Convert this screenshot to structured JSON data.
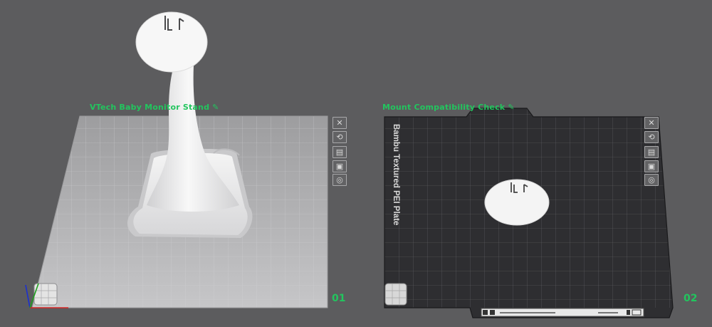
{
  "plates": [
    {
      "name": "VTech Baby Monitor Stand",
      "number": "01",
      "edit_icon": "pencil-icon",
      "surface": "smooth-cool-plate",
      "tools": [
        "close-icon",
        "auto-orient-icon",
        "arrange-icon",
        "lock-icon",
        "settings-icon"
      ]
    },
    {
      "name": "Mount Compatibility Check",
      "number": "02",
      "edit_icon": "pencil-icon",
      "surface": "textured-pei-plate",
      "plate_label": "Bambu Textured PEI Plate",
      "tools": [
        "close-icon",
        "auto-orient-icon",
        "arrange-icon",
        "lock-icon",
        "settings-icon"
      ]
    }
  ],
  "colors": {
    "background": "#5c5c5e",
    "plate_name": "#22c55e",
    "plate1_surface": "#b9b9bb",
    "plate2_surface": "#2f2f31",
    "model": "#f2f2f2"
  }
}
